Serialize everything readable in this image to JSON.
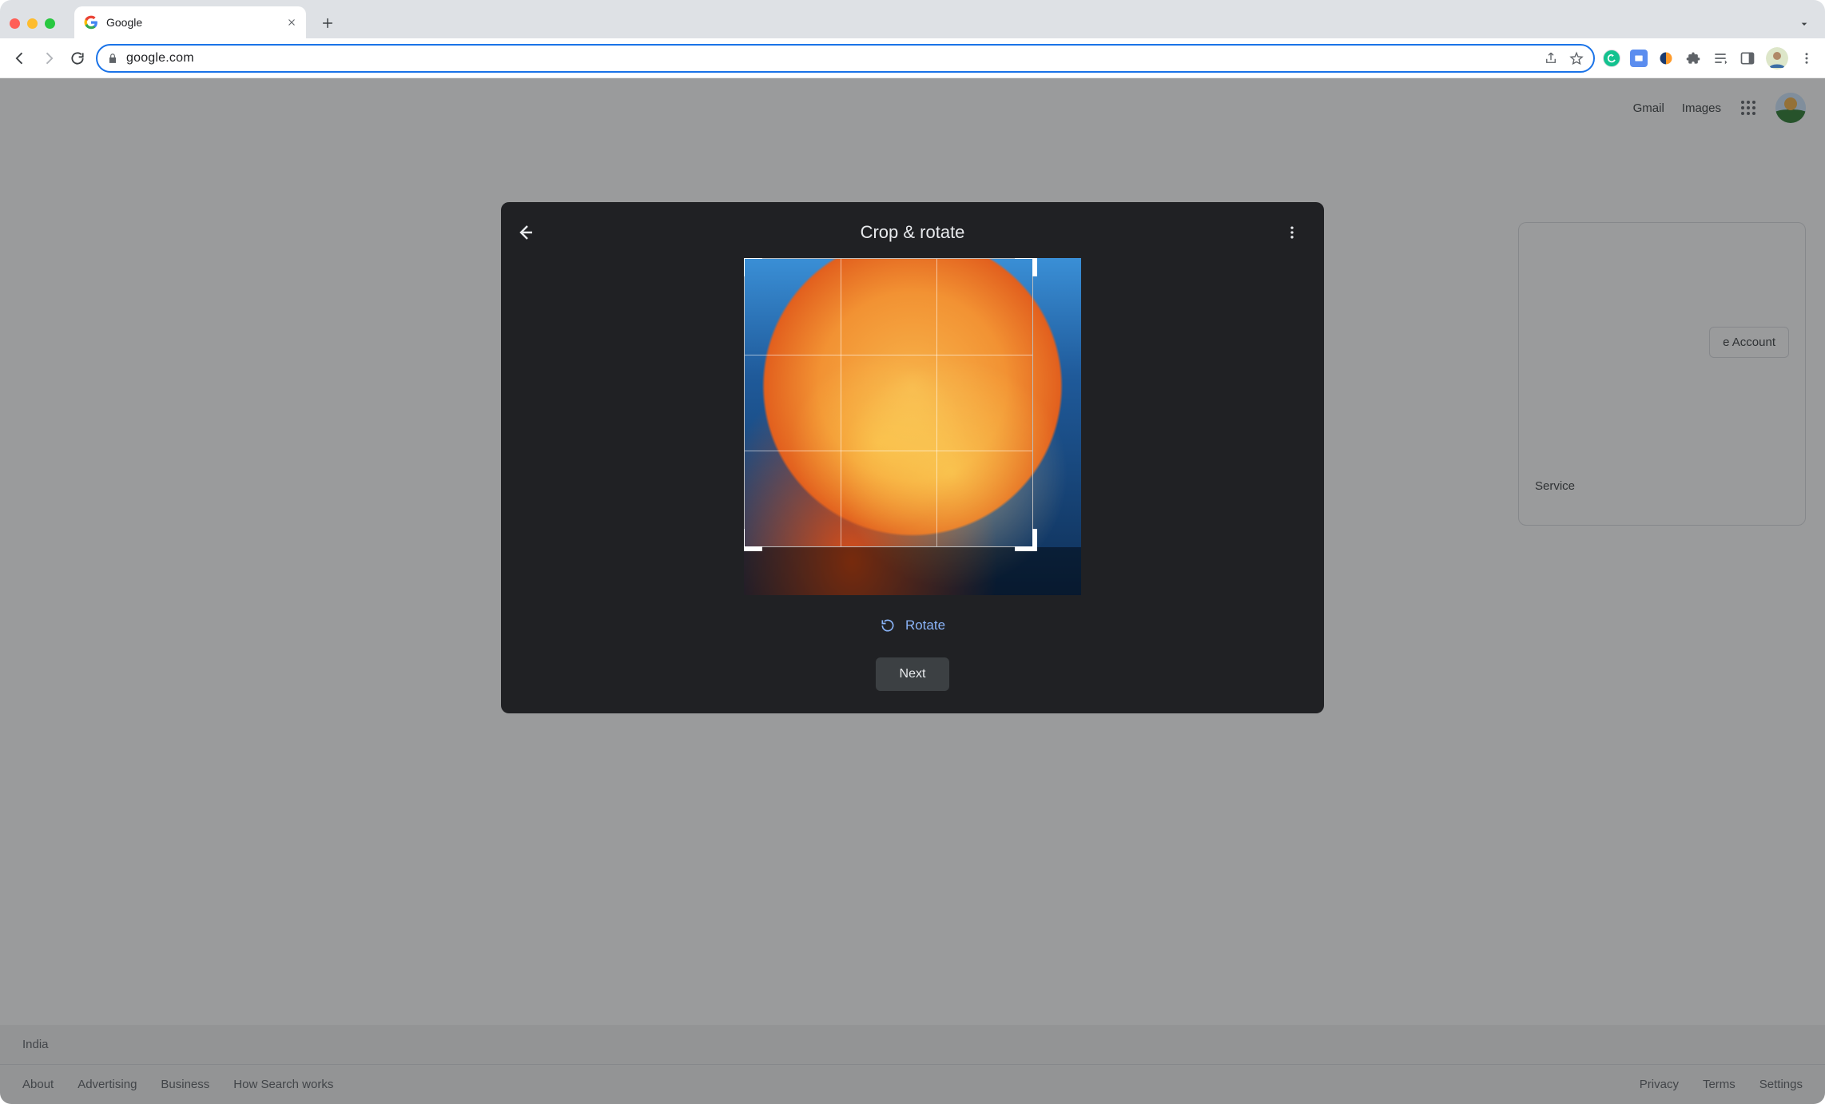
{
  "browser": {
    "tab_title": "Google",
    "url": "google.com",
    "nav": {
      "back_enabled": true,
      "forward_enabled": false
    },
    "icons": {
      "share": "share-icon",
      "star": "star-icon",
      "grammarly": "grammarly-icon",
      "screenshot": "screenshot-icon",
      "similarweb": "similarweb-icon",
      "extensions": "puzzle-icon",
      "readinglist": "readinglist-icon",
      "sidepanel": "sidepanel-icon",
      "profile": "profile-avatar",
      "kebab": "kebab-icon"
    }
  },
  "page": {
    "topnav": {
      "gmail": "Gmail",
      "images": "Images"
    },
    "account_card": {
      "button_fragment": "e Account",
      "line_fragment": "Service"
    },
    "footer": {
      "region": "India",
      "links_left": [
        "About",
        "Advertising",
        "Business",
        "How Search works"
      ],
      "links_right": [
        "Privacy",
        "Terms",
        "Settings"
      ]
    }
  },
  "dialog": {
    "title": "Crop & rotate",
    "rotate_label": "Rotate",
    "next_label": "Next"
  }
}
